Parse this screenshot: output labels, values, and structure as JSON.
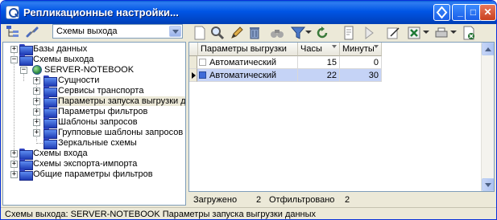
{
  "window": {
    "title": "Репликационные настройки...",
    "min_glyph": "_",
    "max_glyph": "□",
    "close_glyph": "✕"
  },
  "scheme_combo": {
    "value": "Схемы выхода"
  },
  "tree": {
    "nodes": [
      {
        "label": "Базы данных",
        "expander": "+"
      },
      {
        "label": "Схемы выхода",
        "expander": "−"
      },
      {
        "label": "SERVER-NOTEBOOK",
        "expander": "−",
        "icon": "globe-icon"
      },
      {
        "label": "Сущности",
        "expander": "+"
      },
      {
        "label": "Сервисы транспорта",
        "expander": "+"
      },
      {
        "label": "Параметры запуска выгрузки данных",
        "expander": "+"
      },
      {
        "label": "Параметры фильтров",
        "expander": "+"
      },
      {
        "label": "Шаблоны запросов",
        "expander": "+"
      },
      {
        "label": "Групповые шаблоны запросов",
        "expander": "+"
      },
      {
        "label": "Зеркальные схемы",
        "expander": ""
      },
      {
        "label": "Схемы входа",
        "expander": "+"
      },
      {
        "label": "Схемы экспорта-импорта",
        "expander": "+"
      },
      {
        "label": "Общие параметры фильтров",
        "expander": "+"
      }
    ]
  },
  "grid": {
    "columns": [
      "Параметры выгрузки",
      "Часы",
      "Минуты"
    ],
    "rows": [
      {
        "name": "Автоматический",
        "hours": "15",
        "minutes": "0",
        "checked": false
      },
      {
        "name": "Автоматический",
        "hours": "22",
        "minutes": "30",
        "checked": true
      }
    ]
  },
  "counts": {
    "loaded_label": "Загружено",
    "loaded_value": "2",
    "filtered_label": "Отфильтровано",
    "filtered_value": "2"
  },
  "status": {
    "text": "Схемы выхода: SERVER-NOTEBOOK Параметры запуска выгрузки данных"
  },
  "colors": {
    "titlebar": "#0055e5",
    "selection": "#c5d3f6",
    "window": "#ece9d8"
  }
}
